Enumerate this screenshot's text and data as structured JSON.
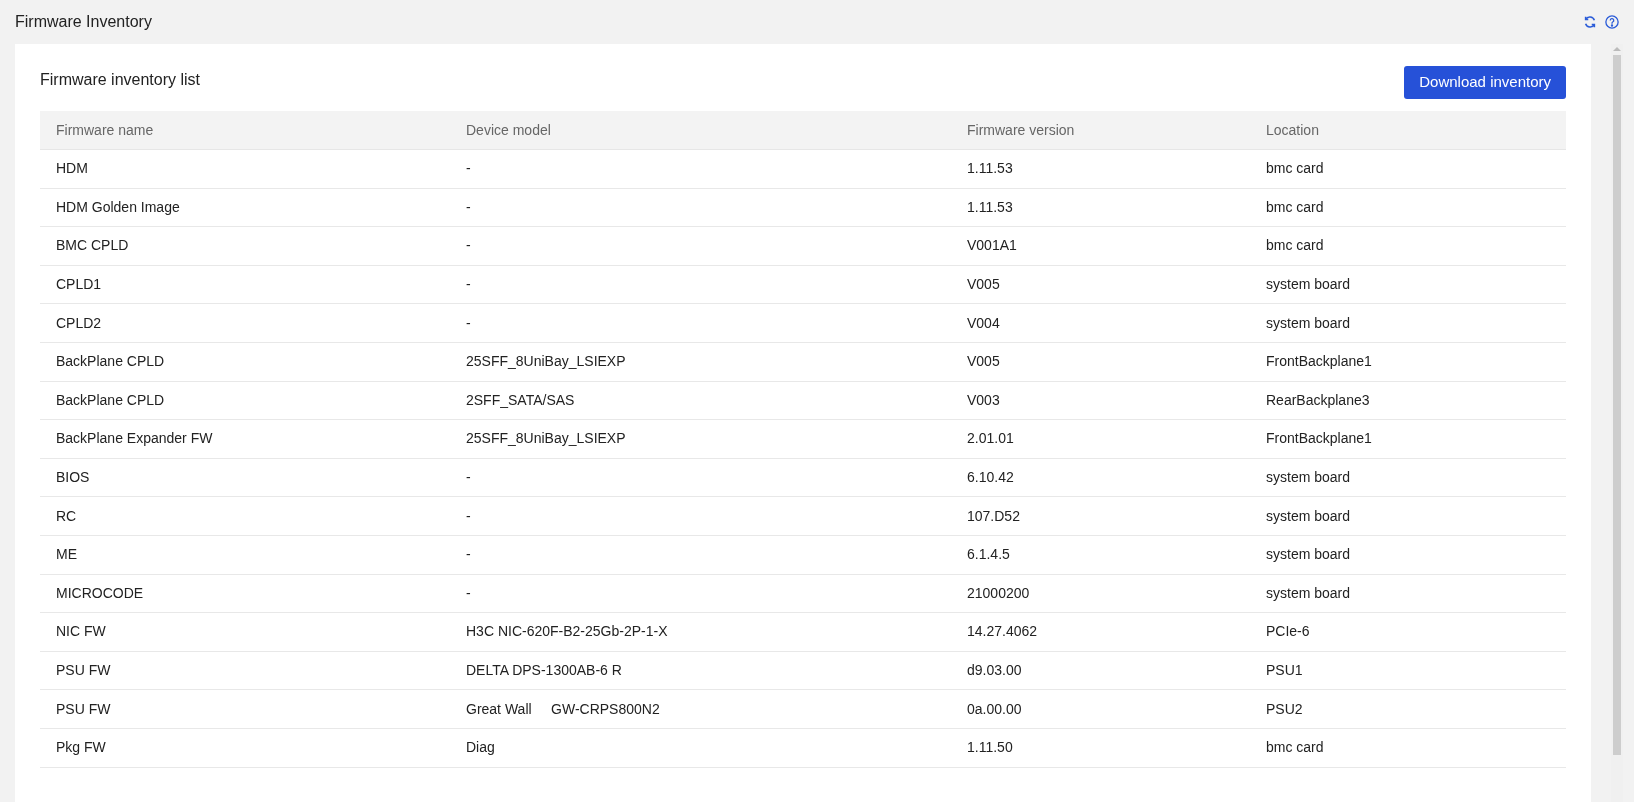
{
  "page_title": "Firmware Inventory",
  "card": {
    "title": "Firmware inventory list",
    "download_button": "Download inventory"
  },
  "table": {
    "columns": [
      "Firmware name",
      "Device model",
      "Firmware version",
      "Location"
    ],
    "rows": [
      [
        "HDM",
        "-",
        "1.11.53",
        "bmc card"
      ],
      [
        "HDM Golden Image",
        "-",
        "1.11.53",
        "bmc card"
      ],
      [
        "BMC CPLD",
        "-",
        "V001A1",
        "bmc card"
      ],
      [
        "CPLD1",
        "-",
        "V005",
        "system board"
      ],
      [
        "CPLD2",
        "-",
        "V004",
        "system board"
      ],
      [
        "BackPlane CPLD",
        "25SFF_8UniBay_LSIEXP",
        "V005",
        "FrontBackplane1"
      ],
      [
        "BackPlane CPLD",
        "2SFF_SATA/SAS",
        "V003",
        "RearBackplane3"
      ],
      [
        "BackPlane Expander FW",
        "25SFF_8UniBay_LSIEXP",
        "2.01.01",
        "FrontBackplane1"
      ],
      [
        "BIOS",
        "-",
        "6.10.42",
        "system board"
      ],
      [
        "RC",
        "-",
        "107.D52",
        "system board"
      ],
      [
        "ME",
        "-",
        "6.1.4.5",
        "system board"
      ],
      [
        "MICROCODE",
        "-",
        "21000200",
        "system board"
      ],
      [
        "NIC FW",
        "H3C NIC-620F-B2-25Gb-2P-1-X",
        "14.27.4062",
        "PCIe-6"
      ],
      [
        "PSU FW",
        "DELTA DPS-1300AB-6 R",
        "d9.03.00",
        "PSU1"
      ],
      [
        "PSU FW",
        "Great Wall     GW-CRPS800N2",
        "0a.00.00",
        "PSU2"
      ],
      [
        "Pkg FW",
        "Diag",
        "1.11.50",
        "bmc card"
      ]
    ]
  }
}
